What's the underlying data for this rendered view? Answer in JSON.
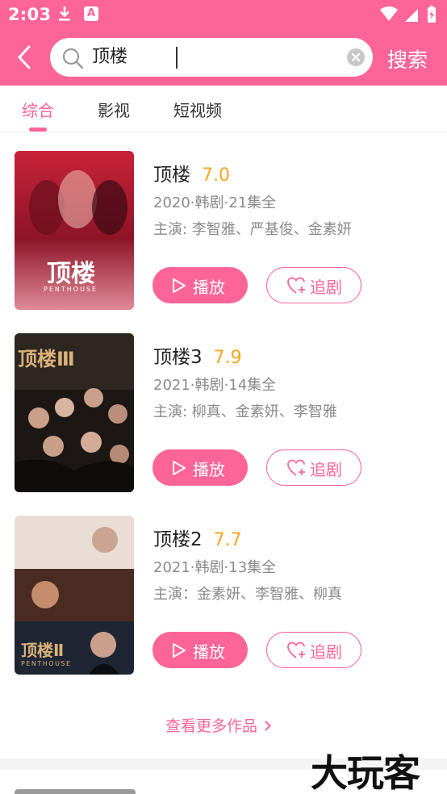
{
  "status_bar": {
    "time": "2:03",
    "a_icon_letter": "A"
  },
  "header": {
    "search_query": "顶楼",
    "search_button": "搜索"
  },
  "tabs": [
    {
      "label": "综合",
      "active": true
    },
    {
      "label": "影视",
      "active": false
    },
    {
      "label": "短视频",
      "active": false
    }
  ],
  "results": [
    {
      "title": "顶楼",
      "score": "7.0",
      "meta": "2020·韩剧·21集全",
      "cast": "主演: 李智雅、严基俊、金素妍",
      "poster_title": "顶楼",
      "poster_subtitle": "PENTHOUSE",
      "play_label": "播放",
      "follow_label": "追剧"
    },
    {
      "title": "顶楼3",
      "score": "7.9",
      "meta": "2021·韩剧·14集全",
      "cast": "主演: 柳真、金素妍、李智雅",
      "poster_title": "顶楼Ⅲ",
      "play_label": "播放",
      "follow_label": "追剧"
    },
    {
      "title": "顶楼2",
      "score": "7.7",
      "meta": "2021·韩剧·13集全",
      "cast": "主演：金素妍、李智雅、柳真",
      "poster_title": "顶楼Ⅱ",
      "poster_subtitle": "PENTHOUSE",
      "play_label": "播放",
      "follow_label": "追剧"
    }
  ],
  "more_link": "查看更多作品",
  "watermark": "大玩客",
  "colors": {
    "accent": "#fd6497",
    "score": "#f5a623",
    "meta": "#8a8a8a"
  }
}
